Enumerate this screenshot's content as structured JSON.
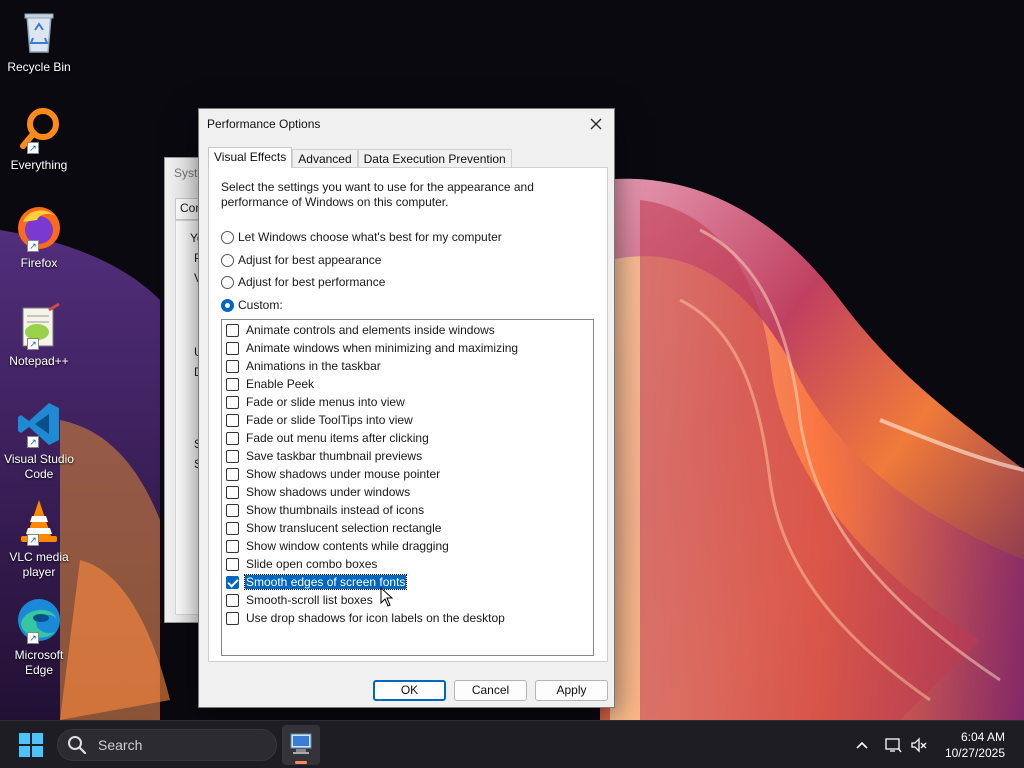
{
  "desktop": {
    "icons": [
      {
        "label": "Recycle Bin",
        "icon": "recycle-bin-icon"
      },
      {
        "label": "Everything",
        "icon": "everything-search-icon"
      },
      {
        "label": "Firefox",
        "icon": "firefox-icon"
      },
      {
        "label": "Notepad++",
        "icon": "notepad-plus-plus-icon"
      },
      {
        "label": "Visual Studio Code",
        "icon": "vscode-icon"
      },
      {
        "label": "VLC media player",
        "icon": "vlc-icon"
      },
      {
        "label": "Microsoft Edge",
        "icon": "edge-icon"
      }
    ]
  },
  "background_window": {
    "title_fragment": "Syste",
    "tab_fragment": "Com",
    "fragments": [
      "Yo",
      "P",
      "V",
      "U",
      "D",
      "S",
      "S"
    ]
  },
  "dialog": {
    "title": "Performance Options",
    "tabs": [
      "Visual Effects",
      "Advanced",
      "Data Execution Prevention"
    ],
    "active_tab": "Visual Effects",
    "description": "Select the settings you want to use for the appearance and performance of Windows on this computer.",
    "radios": [
      {
        "label": "Let Windows choose what's best for my computer",
        "checked": false
      },
      {
        "label": "Adjust for best appearance",
        "checked": false
      },
      {
        "label": "Adjust for best performance",
        "checked": false
      },
      {
        "label": "Custom:",
        "checked": true
      }
    ],
    "options": [
      {
        "label": "Animate controls and elements inside windows",
        "checked": false
      },
      {
        "label": "Animate windows when minimizing and maximizing",
        "checked": false
      },
      {
        "label": "Animations in the taskbar",
        "checked": false
      },
      {
        "label": "Enable Peek",
        "checked": false
      },
      {
        "label": "Fade or slide menus into view",
        "checked": false
      },
      {
        "label": "Fade or slide ToolTips into view",
        "checked": false
      },
      {
        "label": "Fade out menu items after clicking",
        "checked": false
      },
      {
        "label": "Save taskbar thumbnail previews",
        "checked": false
      },
      {
        "label": "Show shadows under mouse pointer",
        "checked": false
      },
      {
        "label": "Show shadows under windows",
        "checked": false
      },
      {
        "label": "Show thumbnails instead of icons",
        "checked": false
      },
      {
        "label": "Show translucent selection rectangle",
        "checked": false
      },
      {
        "label": "Show window contents while dragging",
        "checked": false
      },
      {
        "label": "Slide open combo boxes",
        "checked": false
      },
      {
        "label": "Smooth edges of screen fonts",
        "checked": true,
        "selected": true
      },
      {
        "label": "Smooth-scroll list boxes",
        "checked": false
      },
      {
        "label": "Use drop shadows for icon labels on the desktop",
        "checked": false
      }
    ],
    "buttons": {
      "ok": "OK",
      "cancel": "Cancel",
      "apply": "Apply"
    }
  },
  "taskbar": {
    "search_placeholder": "Search",
    "time": "6:04 AM",
    "date": "10/27/2025"
  },
  "colors": {
    "accent": "#0067c0",
    "taskbar": "#1e1d23"
  }
}
